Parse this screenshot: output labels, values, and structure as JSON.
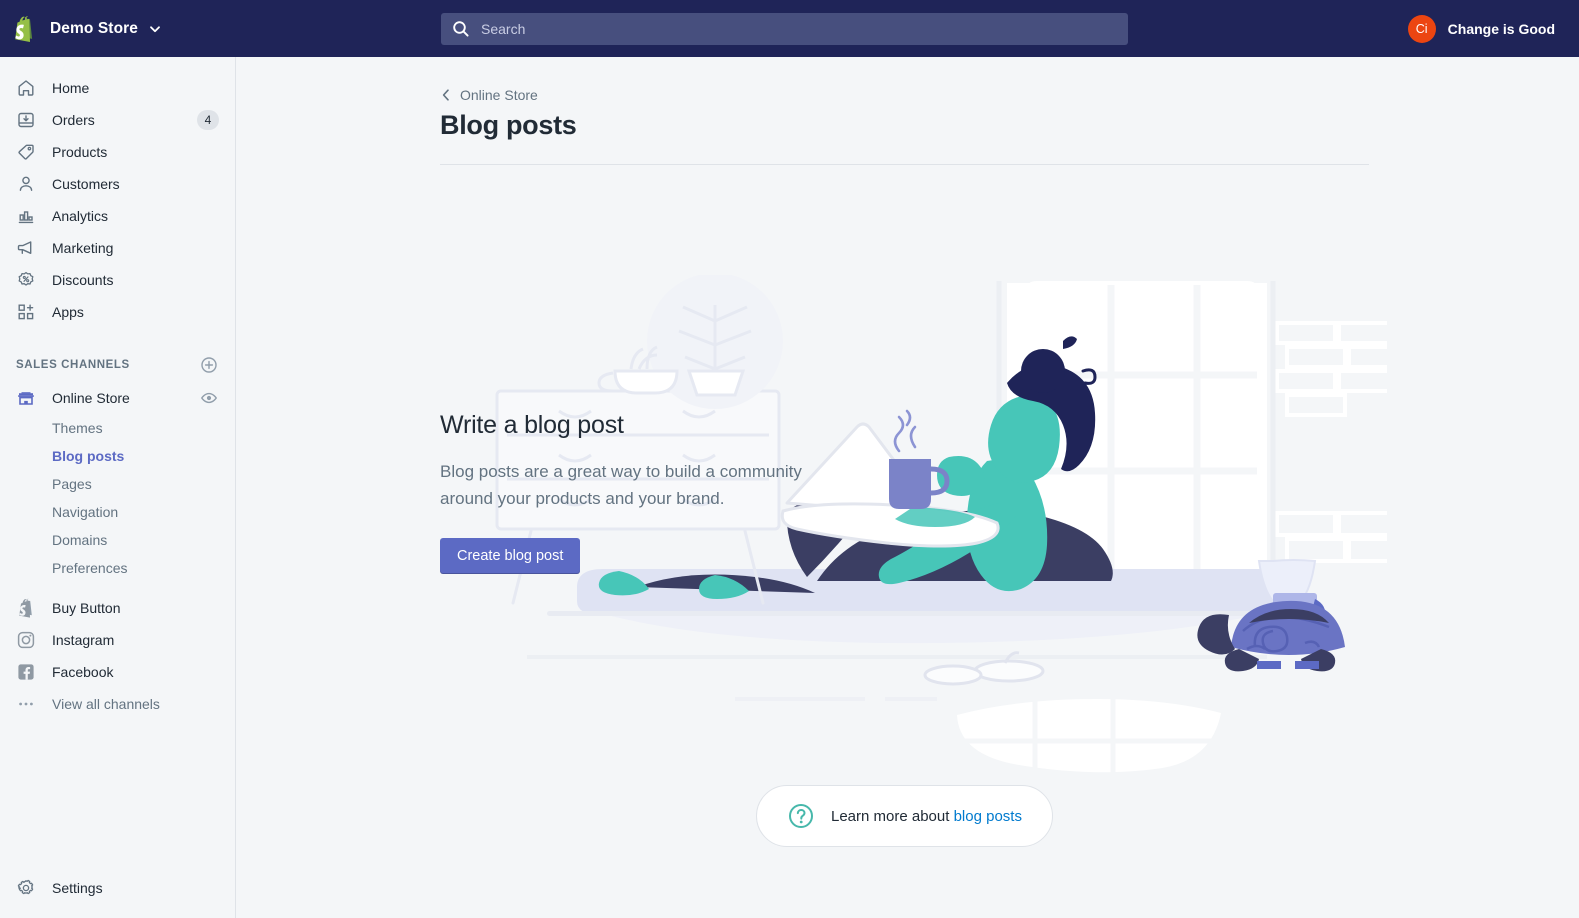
{
  "topbar": {
    "logo_icon": "shopify-bag-icon",
    "store_name": "Demo Store",
    "store_caret_icon": "chevron-down-icon",
    "search": {
      "icon": "search-icon",
      "placeholder": "Search",
      "value": ""
    },
    "user": {
      "avatar_initials": "Ci",
      "avatar_color": "#ec4511",
      "name": "Change is Good"
    },
    "background": "#1f2458"
  },
  "sidebar": {
    "primary_items": [
      {
        "label": "Home",
        "icon": "home-icon",
        "badge": ""
      },
      {
        "label": "Orders",
        "icon": "orders-icon",
        "badge": "4"
      },
      {
        "label": "Products",
        "icon": "products-tag-icon",
        "badge": ""
      },
      {
        "label": "Customers",
        "icon": "customers-person-icon",
        "badge": ""
      },
      {
        "label": "Analytics",
        "icon": "analytics-bar-chart-icon",
        "badge": ""
      },
      {
        "label": "Marketing",
        "icon": "marketing-megaphone-icon",
        "badge": ""
      },
      {
        "label": "Discounts",
        "icon": "discounts-percent-icon",
        "badge": ""
      },
      {
        "label": "Apps",
        "icon": "apps-grid-plus-icon",
        "badge": ""
      }
    ],
    "sales_channels": {
      "title": "Sales channels",
      "add_icon": "plus-circle-icon",
      "online_store": {
        "label": "Online Store",
        "icon": "storefront-icon",
        "view_icon": "eye-icon"
      },
      "sub_items": [
        {
          "label": "Themes",
          "active": false
        },
        {
          "label": "Blog posts",
          "active": true
        },
        {
          "label": "Pages",
          "active": false
        },
        {
          "label": "Navigation",
          "active": false
        },
        {
          "label": "Domains",
          "active": false
        },
        {
          "label": "Preferences",
          "active": false
        }
      ],
      "channels": [
        {
          "label": "Buy Button",
          "icon": "shopify-buy-button-icon"
        },
        {
          "label": "Instagram",
          "icon": "instagram-icon"
        },
        {
          "label": "Facebook",
          "icon": "facebook-icon"
        }
      ],
      "view_all": {
        "label": "View all channels",
        "icon": "ellipsis-icon"
      }
    },
    "settings": {
      "label": "Settings",
      "icon": "gear-icon"
    },
    "active_color": "#5c6ac4"
  },
  "main": {
    "breadcrumb": {
      "label": "Online Store",
      "icon": "chevron-left-icon"
    },
    "page_title": "Blog posts",
    "empty_state": {
      "title": "Write a blog post",
      "body": "Blog posts are a great way to build a community around your products and your brand.",
      "cta_label": "Create blog post",
      "cta_color": "#5c6ac4",
      "illustration": "person-sitting-on-window-sill-with-laptop-and-coffee"
    },
    "footer_help": {
      "icon": "question-mark-circle-icon",
      "text": "Learn more about",
      "link": "blog posts",
      "link_color": "#007ace"
    }
  }
}
